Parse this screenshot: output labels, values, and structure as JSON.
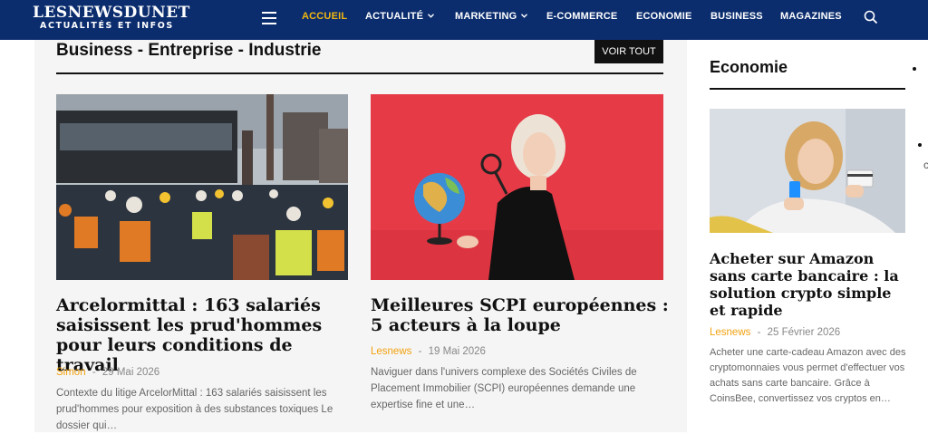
{
  "header": {
    "logo_main": "LESNEWSDUNET",
    "logo_sub": "ACTUALITÉS ET INFOS",
    "nav": [
      {
        "label": "ACCUEIL"
      },
      {
        "label": "ACTUALITÉ"
      },
      {
        "label": "MARKETING"
      },
      {
        "label": "E-COMMERCE"
      },
      {
        "label": "ECONOMIE"
      },
      {
        "label": "BUSINESS"
      },
      {
        "label": "MAGAZINES"
      }
    ],
    "chevron": "⌄",
    "accent": "#f2b70f",
    "background": "#0b2d6e"
  },
  "section": {
    "title": "Business - Entreprise - Industrie",
    "view_all": "VOIR TOUT"
  },
  "articles": [
    {
      "title": "Arcelormittal : 163 salariés saisissent les prud'hommes pour leurs conditions de travail",
      "author": "Simon",
      "separator": "-",
      "date": "29 Mai 2026",
      "excerpt": "Contexte du litige ArcelorMittal : 163 salariés saisissent les prud'hommes pour exposition à des substances toxiques Le dossier qui…"
    },
    {
      "title": "Meilleures SCPI européennes : 5 acteurs à la loupe",
      "author": "Lesnews",
      "separator": "-",
      "date": "19 Mai 2026",
      "excerpt": "Naviguer dans l'univers complexe des Sociétés Civiles de Placement Immobilier (SCPI) européennes demande une expertise fine et une…"
    }
  ],
  "sidebar": {
    "title": "Economie",
    "article": {
      "title": "Acheter sur Amazon sans carte bancaire : la solution crypto simple et rapide",
      "author": "Lesnews",
      "separator": "-",
      "date": "25 Février 2026",
      "excerpt": "Acheter une carte-cadeau Amazon avec des cryptomonnaies vous permet d'effectuer vos achats sans carte bancaire. Grâce à CoinsBee, convertissez vos cryptos en…"
    },
    "edge_glyph": "c"
  }
}
